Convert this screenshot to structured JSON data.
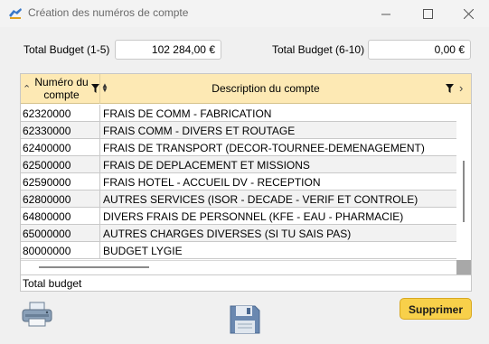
{
  "window": {
    "title": "Création des numéros de compte"
  },
  "budgets": {
    "label_1_5": "Total Budget (1-5)",
    "value_1_5": "102 284,00 €",
    "label_6_10": "Total Budget (6-10)",
    "value_6_10": "0,00 €"
  },
  "grid": {
    "columns": [
      "Numéro du compte",
      "Description du compte"
    ],
    "rows": [
      {
        "num": "62320000",
        "desc": "FRAIS DE COMM - FABRICATION"
      },
      {
        "num": "62330000",
        "desc": "FRAIS COMM - DIVERS ET ROUTAGE"
      },
      {
        "num": "62400000",
        "desc": "FRAIS DE TRANSPORT (DECOR-TOURNEE-DEMENAGEMENT)"
      },
      {
        "num": "62500000",
        "desc": "FRAIS DE DEPLACEMENT ET MISSIONS"
      },
      {
        "num": "62590000",
        "desc": "FRAIS HOTEL - ACCUEIL DV - RECEPTION"
      },
      {
        "num": "62800000",
        "desc": "AUTRES SERVICES (ISOR - DECADE - VERIF ET CONTROLE)"
      },
      {
        "num": "64800000",
        "desc": "DIVERS FRAIS DE PERSONNEL (KFE - EAU - PHARMACIE)"
      },
      {
        "num": "65000000",
        "desc": "AUTRES CHARGES DIVERSES (SI TU SAIS PAS)"
      },
      {
        "num": "80000000",
        "desc": "BUDGET LYGIE"
      }
    ],
    "footer_label": "Total budget"
  },
  "actions": {
    "delete_label": "Supprimer",
    "print_icon": "printer-icon",
    "save_icon": "floppy-disk-icon"
  }
}
